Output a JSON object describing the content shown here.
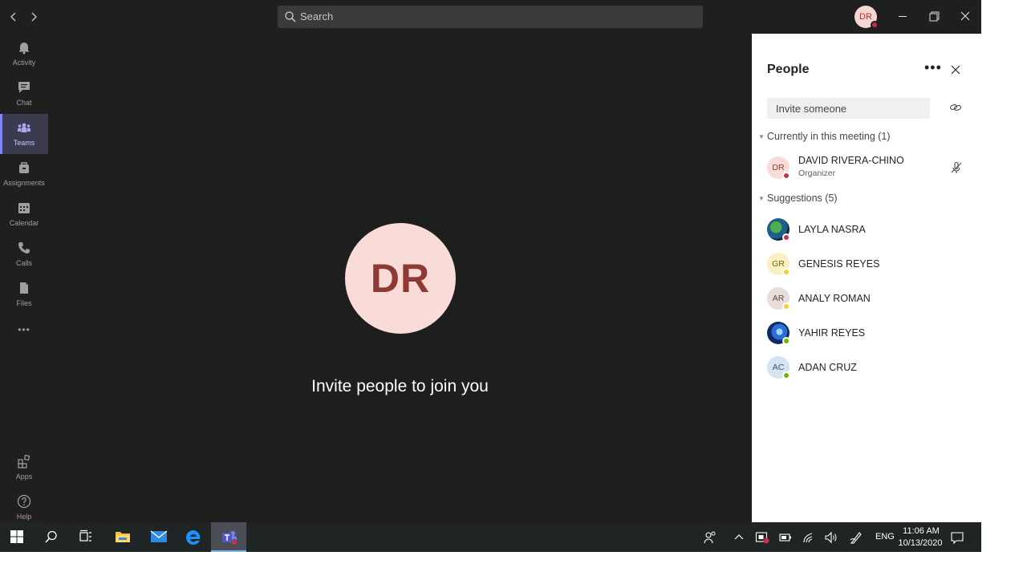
{
  "titlebar": {
    "search_placeholder": "Search",
    "user_initials": "DR"
  },
  "rail": {
    "items": [
      {
        "label": "Activity",
        "icon": "bell-icon"
      },
      {
        "label": "Chat",
        "icon": "chat-icon"
      },
      {
        "label": "Teams",
        "icon": "teams-icon",
        "active": true
      },
      {
        "label": "Assignments",
        "icon": "assignments-icon"
      },
      {
        "label": "Calendar",
        "icon": "calendar-icon"
      },
      {
        "label": "Calls",
        "icon": "phone-icon"
      },
      {
        "label": "Files",
        "icon": "file-icon"
      }
    ],
    "more_label": "•••",
    "bottom": [
      {
        "label": "Apps",
        "icon": "apps-icon"
      },
      {
        "label": "Help",
        "icon": "help-icon"
      }
    ]
  },
  "stage": {
    "avatar_initials": "DR",
    "message": "Invite people to join you"
  },
  "people": {
    "title": "People",
    "more_label": "•••",
    "invite_placeholder": "Invite someone",
    "current_header": "Currently in this meeting",
    "current_count": "(1)",
    "current": [
      {
        "initials": "DR",
        "name": "DAVID RIVERA-CHINO",
        "role": "Organizer",
        "status": "busy"
      }
    ],
    "suggestions_header": "Suggestions",
    "suggestions_count": "(5)",
    "suggestions": [
      {
        "initials": "",
        "name": "LAYLA NASRA",
        "status": "busy",
        "photo": "globe"
      },
      {
        "initials": "GR",
        "name": "GENESIS REYES",
        "status": "away"
      },
      {
        "initials": "AR",
        "name": "ANALY ROMAN",
        "status": "away"
      },
      {
        "initials": "",
        "name": "YAHIR REYES",
        "status": "available",
        "photo": "swirl"
      },
      {
        "initials": "AC",
        "name": "ADAN CRUZ",
        "status": "available"
      }
    ]
  },
  "taskbar": {
    "language": "ENG",
    "time": "11:06 AM",
    "date": "10/13/2020"
  },
  "colors": {
    "accent": "#7f85f5",
    "busy": "#c4314b",
    "away": "#f8d22a",
    "available": "#6bb700",
    "dark_bg": "#201f1f"
  }
}
